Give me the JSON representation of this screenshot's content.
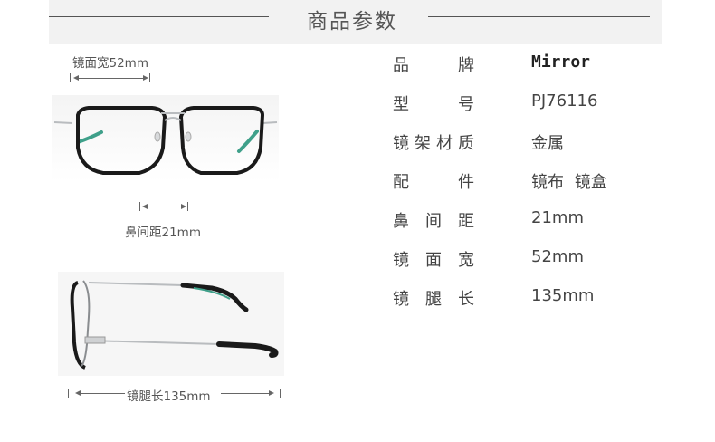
{
  "header": {
    "title": "商品参数"
  },
  "front_view": {
    "lens_width_label": "镜面宽52mm",
    "bridge_label": "鼻间距21mm"
  },
  "side_view": {
    "temple_label": "镜腿长135mm"
  },
  "specs": [
    {
      "label_chars": [
        "品",
        "牌"
      ],
      "value": "Mirror"
    },
    {
      "label_chars": [
        "型",
        "号"
      ],
      "value": "PJ76116"
    },
    {
      "label_chars": [
        "镜",
        "架",
        "材",
        "质"
      ],
      "value": "金属"
    },
    {
      "label_chars": [
        "配",
        "件"
      ],
      "value": "镜布 镜盒"
    },
    {
      "label_chars": [
        "鼻",
        "间",
        "距"
      ],
      "value": "21mm"
    },
    {
      "label_chars": [
        "镜",
        "面",
        "宽"
      ],
      "value": "52mm"
    },
    {
      "label_chars": [
        "镜",
        "腿",
        "长"
      ],
      "value": "135mm"
    }
  ],
  "colors": {
    "frame_black": "#1a1a1a",
    "metal_silver": "#b9bcbf",
    "temple_tip_green": "#3fa08a"
  }
}
